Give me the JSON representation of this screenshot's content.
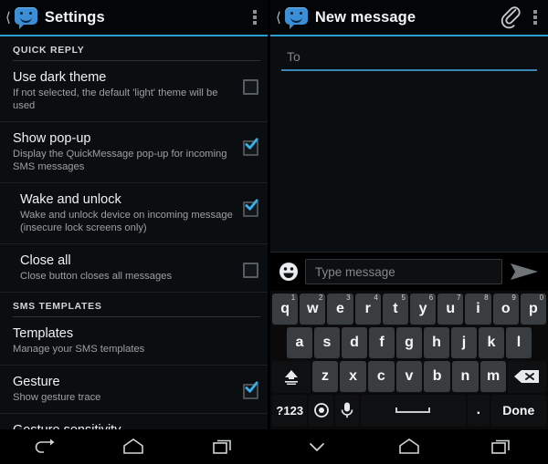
{
  "left_screen": {
    "actionbar": {
      "back_icon": "back-chevron-icon",
      "app_icon": "speech-bubble-smiley-icon",
      "title": "Settings",
      "overflow_icon": "overflow-menu-icon"
    },
    "sections": [
      {
        "header": "QUICK REPLY",
        "rows": [
          {
            "title": "Use dark theme",
            "summary": "If not selected, the default 'light' theme will be used",
            "checked": false,
            "indent": false
          },
          {
            "title": "Show pop-up",
            "summary": "Display the QuickMessage pop-up for incoming SMS messages",
            "checked": true,
            "indent": false
          },
          {
            "title": "Wake and unlock",
            "summary": "Wake and unlock device on incoming message (insecure lock screens only)",
            "checked": true,
            "indent": true
          },
          {
            "title": "Close all",
            "summary": "Close button closes all messages",
            "checked": false,
            "indent": true
          }
        ]
      },
      {
        "header": "SMS TEMPLATES",
        "rows": [
          {
            "title": "Templates",
            "summary": "Manage your SMS templates",
            "checked": null,
            "indent": false
          },
          {
            "title": "Gesture",
            "summary": "Show gesture trace",
            "checked": true,
            "indent": false
          },
          {
            "title": "Gesture sensitivity",
            "summary": "",
            "checked": null,
            "indent": false
          }
        ]
      }
    ],
    "navbar": {
      "back": "back-arrow-icon",
      "home": "home-icon",
      "recents": "recent-apps-icon"
    }
  },
  "right_screen": {
    "actionbar": {
      "back_icon": "back-chevron-icon",
      "app_icon": "speech-bubble-smiley-icon",
      "title": "New message",
      "attach_icon": "paperclip-icon",
      "overflow_icon": "overflow-menu-icon"
    },
    "recipient_field": {
      "placeholder": "To",
      "value": ""
    },
    "message_bar": {
      "emoji_icon": "emoji-smiley-icon",
      "placeholder": "Type message",
      "value": "",
      "send_icon": "send-arrow-icon"
    },
    "keyboard": {
      "row1": [
        {
          "label": "q",
          "sup": "1"
        },
        {
          "label": "w",
          "sup": "2"
        },
        {
          "label": "e",
          "sup": "3"
        },
        {
          "label": "r",
          "sup": "4"
        },
        {
          "label": "t",
          "sup": "5"
        },
        {
          "label": "y",
          "sup": "6"
        },
        {
          "label": "u",
          "sup": "7"
        },
        {
          "label": "i",
          "sup": "8"
        },
        {
          "label": "o",
          "sup": "9"
        },
        {
          "label": "p",
          "sup": "0"
        }
      ],
      "row2": [
        {
          "label": "a"
        },
        {
          "label": "s"
        },
        {
          "label": "d"
        },
        {
          "label": "f"
        },
        {
          "label": "g"
        },
        {
          "label": "h"
        },
        {
          "label": "j"
        },
        {
          "label": "k"
        },
        {
          "label": "l"
        }
      ],
      "row3_shift": "shift-key-icon",
      "row3": [
        {
          "label": "z"
        },
        {
          "label": "x"
        },
        {
          "label": "c"
        },
        {
          "label": "v"
        },
        {
          "label": "b"
        },
        {
          "label": "n"
        },
        {
          "label": "m"
        }
      ],
      "row3_delete": "backspace-key-icon",
      "row4": {
        "symbols_label": "?123",
        "settings_icon": "keyboard-settings-icon",
        "mic_icon": "microphone-icon",
        "space_label": "",
        "period_label": ".",
        "done_label": "Done"
      }
    },
    "navbar": {
      "hide_keyboard": "hide-keyboard-chevron-icon",
      "home": "home-icon",
      "recents": "recent-apps-icon"
    }
  },
  "colors": {
    "accent": "#2a9fd6",
    "checkbox_checked": "#38b0e8",
    "underline": "#3c86b5",
    "background": "#0b0e11",
    "actionbar_bg": "#040506",
    "key_bg": "#3a3d3f"
  }
}
